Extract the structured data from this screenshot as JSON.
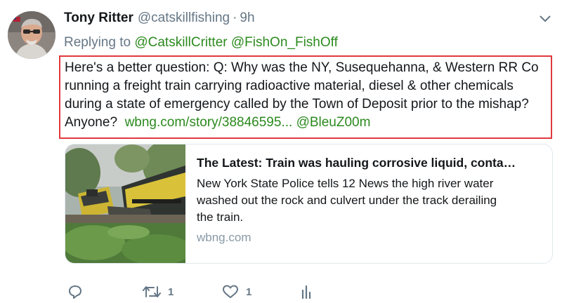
{
  "tweet": {
    "author_name": "Tony Ritter",
    "author_handle": "@catskillfishing",
    "separator": "·",
    "time": "9h",
    "reply_prefix": "Replying to",
    "reply_to": [
      "@CatskillCritter",
      "@FishOn_FishOff"
    ],
    "text_lines": [
      "Here's a better question:  Q: Why was the NY, Susequehanna, & Western RR Co",
      "running a  freight train carrying radioactive material, diesel & other chemicals",
      "during a state of emergency called by the Town of Deposit prior to the mishap?"
    ],
    "text_last_line_prefix": "Anyone?  ",
    "link_url": "wbng.com/story/38846595...",
    "mention": "@BleuZ00m"
  },
  "card": {
    "title": "The Latest: Train was hauling corrosive liquid, conta…",
    "description_lines": [
      "New York State Police tells 12 News the high river water",
      "washed out the rock and culvert under the track derailing",
      "the train."
    ],
    "domain": "wbng.com",
    "image_icon": "derailed-train-photo"
  },
  "actions": {
    "reply_icon": "reply-icon",
    "retweet_icon": "retweet-icon",
    "retweet_count": "1",
    "like_icon": "heart-icon",
    "like_count": "1",
    "analytics_icon": "analytics-icon"
  },
  "colors": {
    "link_green": "#2b8a1e",
    "highlight_border": "#e0393e",
    "muted": "#657786",
    "text": "#14171a"
  }
}
